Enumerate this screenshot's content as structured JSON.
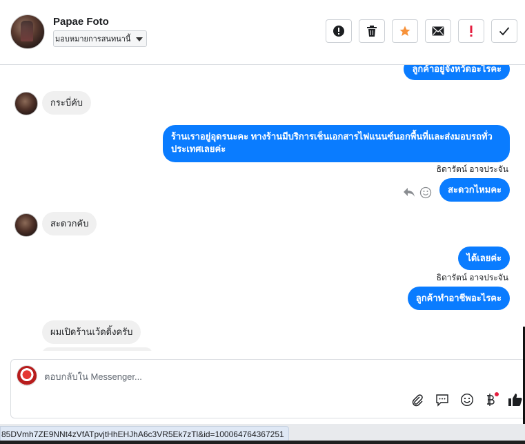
{
  "header": {
    "contact_name": "Papae Foto",
    "assign_value": "มอบหมายการสนทนานี้",
    "buttons": [
      {
        "name": "report-spam",
        "icon": "exclamation-circle-icon"
      },
      {
        "name": "delete",
        "icon": "trash-icon"
      },
      {
        "name": "star",
        "icon": "star-icon",
        "color": "#f7923a"
      },
      {
        "name": "mark-unread",
        "icon": "envelope-icon"
      },
      {
        "name": "follow-up",
        "icon": "exclamation-icon",
        "color": "#e41e3f"
      },
      {
        "name": "mark-done",
        "icon": "check-icon"
      }
    ]
  },
  "messages": {
    "m0": "ลูกค้าอยู่จังหวัดอะไรคะ",
    "m1": "กระบี่คับ",
    "m2": "ร้านเราอยู่อุดรนะคะ ทางร้านมีบริการเช็นเอกสารไฟแนนซ์นอกพื้นที่และส่งมอบรถทั่วประเทศเลยค่ะ",
    "m2_sender": "ธิดารัตน์ อาจประจัน",
    "m3": "สะดวกไหมคะ",
    "m4": "สะดวกคับ",
    "m5": "ได้เลยค่ะ",
    "m5_sender": "ธิดารัตน์ อาจประจัน",
    "m6": "ลูกค้าทำอาชีพอะไรคะ",
    "m7": "ผมเปิดร้านเว้ดดิ้งครับ"
  },
  "composer": {
    "placeholder": "ตอบกลับใน Messenger...",
    "icons": [
      "paperclip-icon",
      "saved-replies-icon",
      "emoji-icon",
      "payment-baht-icon",
      "like-icon"
    ],
    "accent": "#e41e3f"
  },
  "status_url": "85DVmh7ZE9NNt4zVfATpvjtHhEHJhA6c3VR5Ek7zTl&id=100064764367251",
  "colors": {
    "outgoing": "#0a7cff",
    "incoming": "#f0f0f0"
  }
}
